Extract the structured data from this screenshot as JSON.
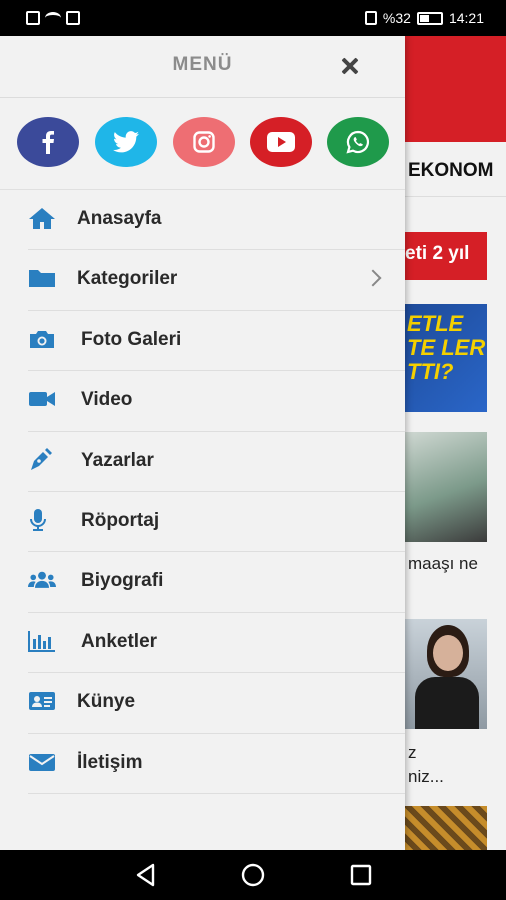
{
  "status_bar": {
    "battery": "%32",
    "time": "14:21"
  },
  "drawer": {
    "title": "MENÜ",
    "socials": [
      {
        "name": "facebook-icon",
        "color": "#3b4a9a"
      },
      {
        "name": "twitter-icon",
        "color": "#1fb6e8"
      },
      {
        "name": "instagram-icon",
        "color": "#ee6e73"
      },
      {
        "name": "youtube-icon",
        "color": "#d51f26"
      },
      {
        "name": "whatsapp-icon",
        "color": "#1f9a4b"
      }
    ],
    "items": [
      {
        "label": "Anasayfa",
        "icon": "home-icon"
      },
      {
        "label": "Kategoriler",
        "icon": "folder-icon",
        "has_submenu": true
      },
      {
        "label": "Foto Galeri",
        "icon": "camera-icon"
      },
      {
        "label": "Video",
        "icon": "video-camera-icon"
      },
      {
        "label": "Yazarlar",
        "icon": "pen-icon"
      },
      {
        "label": "Röportaj",
        "icon": "microphone-icon"
      },
      {
        "label": "Biyografi",
        "icon": "users-icon"
      },
      {
        "label": "Anketler",
        "icon": "bar-chart-icon"
      },
      {
        "label": "Künye",
        "icon": "id-card-icon"
      },
      {
        "label": "İletişim",
        "icon": "envelope-icon"
      }
    ],
    "accent": "#2a7fc0"
  },
  "background_app": {
    "category": "EKONOM",
    "badge": "eti 2 yıl",
    "banner_text": "ETLE TE LER TTI?",
    "headline_1": "maaşı ne",
    "headline_2_line1": "z",
    "headline_2_line2": "niz..."
  }
}
